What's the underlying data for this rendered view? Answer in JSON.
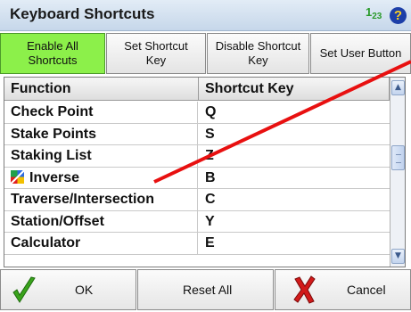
{
  "window": {
    "title": "Keyboard Shortcuts",
    "mode_indicator": {
      "main": "1",
      "sub_a": "2",
      "sub_b": "3"
    },
    "help_label": "?"
  },
  "toolbar": {
    "buttons": [
      {
        "label": "Enable All\nShortcuts",
        "active": true
      },
      {
        "label": "Set Shortcut\nKey",
        "active": false
      },
      {
        "label": "Disable Shortcut\nKey",
        "active": false
      },
      {
        "label": "Set User Button",
        "active": false
      }
    ]
  },
  "table": {
    "headers": [
      "Function",
      "Shortcut Key"
    ],
    "rows": [
      {
        "function": "Check Point",
        "key": "Q"
      },
      {
        "function": "Stake Points",
        "key": "S"
      },
      {
        "function": "Staking List",
        "key": "Z"
      },
      {
        "function": "Inverse",
        "key": "B",
        "icon": "inverse-icon"
      },
      {
        "function": "Traverse/Intersection",
        "key": "C"
      },
      {
        "function": "Station/Offset",
        "key": "Y"
      },
      {
        "function": "Calculator",
        "key": "E"
      }
    ]
  },
  "footer": {
    "ok_label": "OK",
    "reset_label": "Reset All",
    "cancel_label": "Cancel"
  },
  "colors": {
    "active_button": "#8cf04a",
    "annotation": "#e81010",
    "ok_icon": "#3aa31c",
    "cancel_icon": "#d21a1a"
  },
  "icons": {
    "ok": "check-icon",
    "cancel": "x-icon",
    "help": "help-icon",
    "scroll_up": "scroll-up-icon",
    "scroll_down": "scroll-down-icon"
  }
}
